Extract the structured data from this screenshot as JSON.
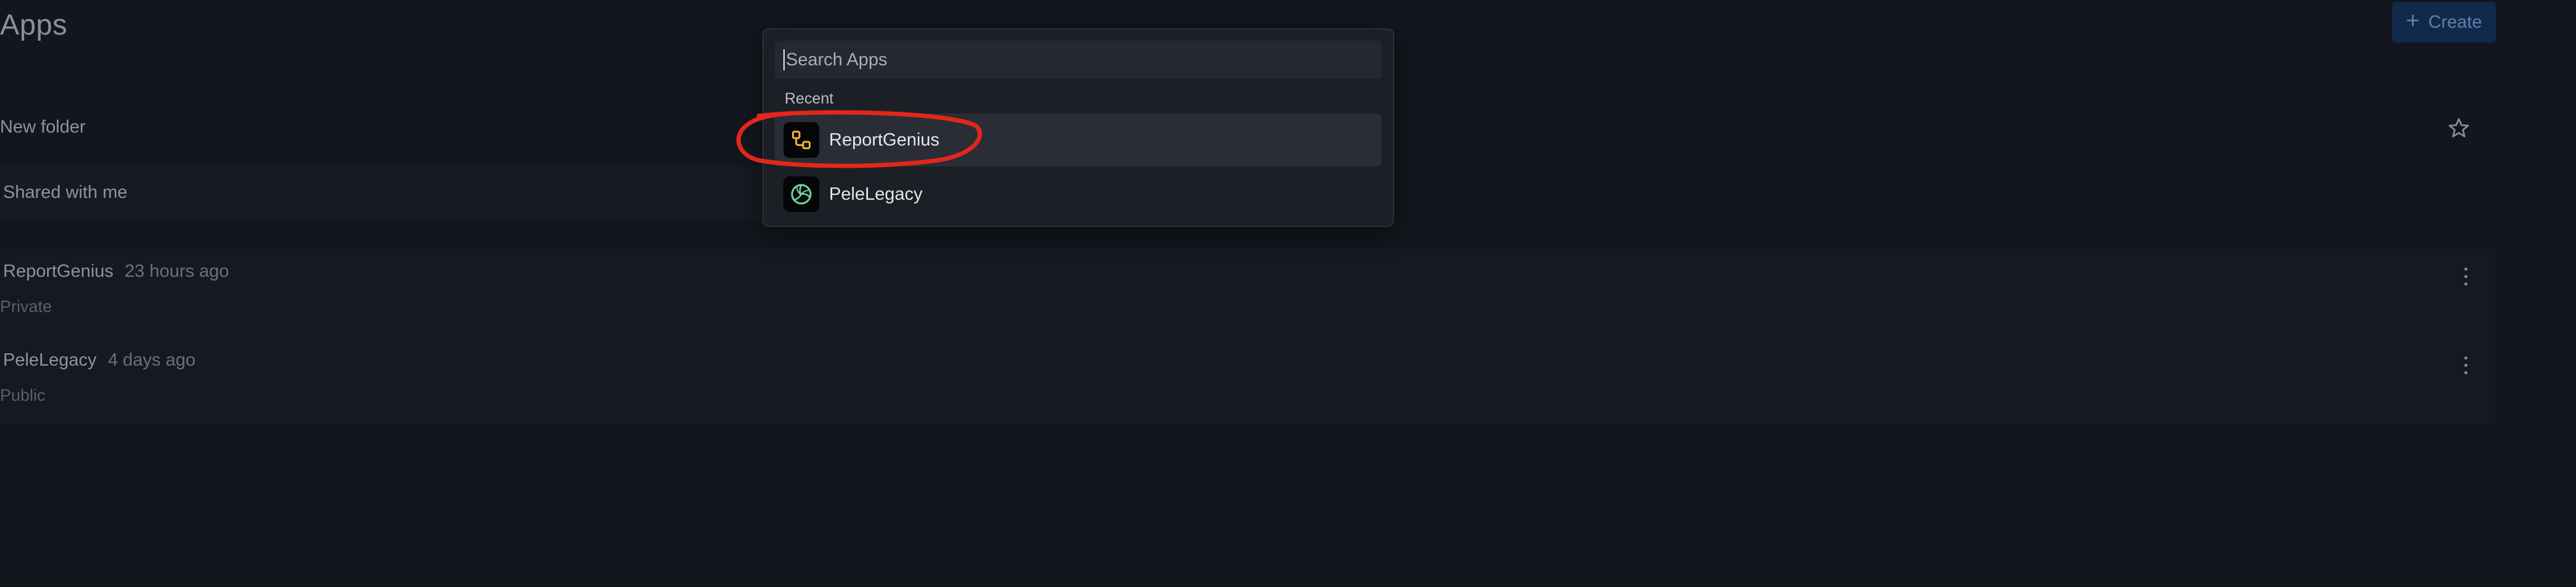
{
  "page": {
    "title": "Apps",
    "create_label": "Create",
    "folder_label": "New folder",
    "shared_label": "Shared with me"
  },
  "apps": [
    {
      "name": "ReportGenius",
      "time": "23 hours ago",
      "visibility": "Private"
    },
    {
      "name": "PeleLegacy",
      "time": "4 days ago",
      "visibility": "Public"
    }
  ],
  "palette": {
    "search_placeholder": "Search Apps",
    "section_label": "Recent",
    "results": [
      {
        "label": "ReportGenius",
        "icon": "workflow-icon",
        "icon_color": "#f2b632",
        "highlighted": true
      },
      {
        "label": "PeleLegacy",
        "icon": "volleyball-icon",
        "icon_color": "#6fd6a0",
        "highlighted": false
      }
    ]
  },
  "colors": {
    "background": "#13161d",
    "accent": "#0f2a4a",
    "annotation": "#e3261b"
  }
}
